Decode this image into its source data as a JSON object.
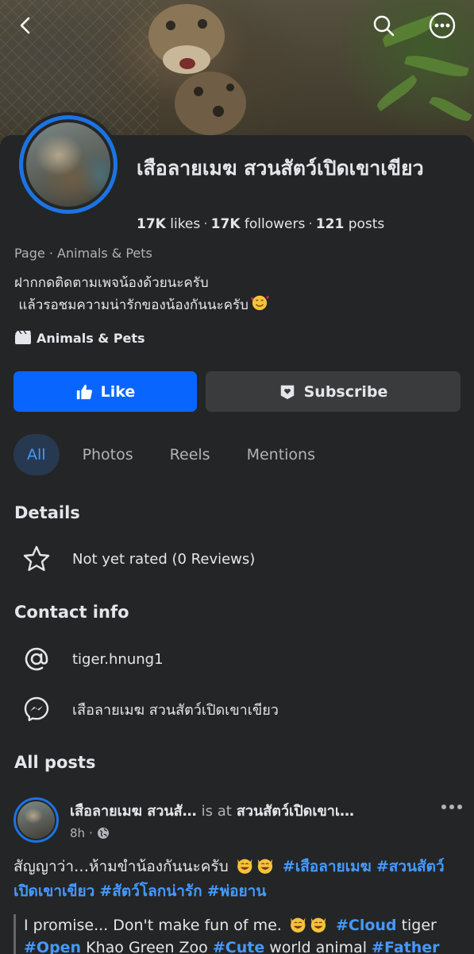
{
  "page": {
    "name": "เสือลายเมฆ สวนสัตว์เปิดเขาเขียว",
    "likes_count": "17K",
    "likes_label": "likes",
    "followers_count": "17K",
    "followers_label": "followers",
    "posts_count": "121",
    "posts_label": "posts",
    "category_line": "Page · Animals & Pets",
    "bio": "ฝากกดติดตามเพจน้องด้วยนะครับ\n แล้วรอชมความน่ารักของน้องกันนะครับ",
    "category": "Animals & Pets"
  },
  "actions": {
    "like_label": "Like",
    "subscribe_label": "Subscribe"
  },
  "tabs": [
    {
      "label": "All",
      "active": true
    },
    {
      "label": "Photos"
    },
    {
      "label": "Reels"
    },
    {
      "label": "Mentions"
    }
  ],
  "details": {
    "title": "Details",
    "rating": "Not yet rated (0 Reviews)"
  },
  "contact": {
    "title": "Contact info",
    "instagram": "tiger.hnung1",
    "messenger": "เสือลายเมฆ สวนสัตว์เปิดเขาเขียว"
  },
  "posts": {
    "title": "All posts",
    "items": [
      {
        "author": "เสือลายเมฆ สวนสั…",
        "is_at": "is at",
        "location": "สวนสัตว์เปิดเขาเ…",
        "time": "8h",
        "text_plain": "สัญญาว่า…ห้ามขำน้องกันนะครับ",
        "tag1": "#เสือลายเมฆ",
        "tag2": "#สวนสัตว์เปิดเขาเขียว",
        "tag3": "#สัตว์โลกน่ารัก",
        "tag4": "#พ่อยาน",
        "quote_1": "I promise... Don't make fun of me.",
        "quote_tag1": "#Cloud",
        "quote_2": "tiger",
        "quote_tag2": "#Open",
        "quote_3": "Khao Green Zoo",
        "quote_tag3": "#Cute",
        "quote_4": "world animal",
        "quote_tag4": "#Father"
      }
    ]
  },
  "icons": {
    "back": "back-arrow-icon",
    "search": "search-icon",
    "more": "more-icon",
    "like": "thumbs-up-icon",
    "subscribe": "subscribe-icon",
    "star": "star-icon",
    "instagram": "at-sign-icon",
    "messenger": "messenger-icon",
    "globe": "globe-icon",
    "category": "clapperboard-icon"
  },
  "colors": {
    "accent": "#0866ff",
    "link": "#4599ff",
    "background": "#242526",
    "ring": "#1b74e4"
  }
}
